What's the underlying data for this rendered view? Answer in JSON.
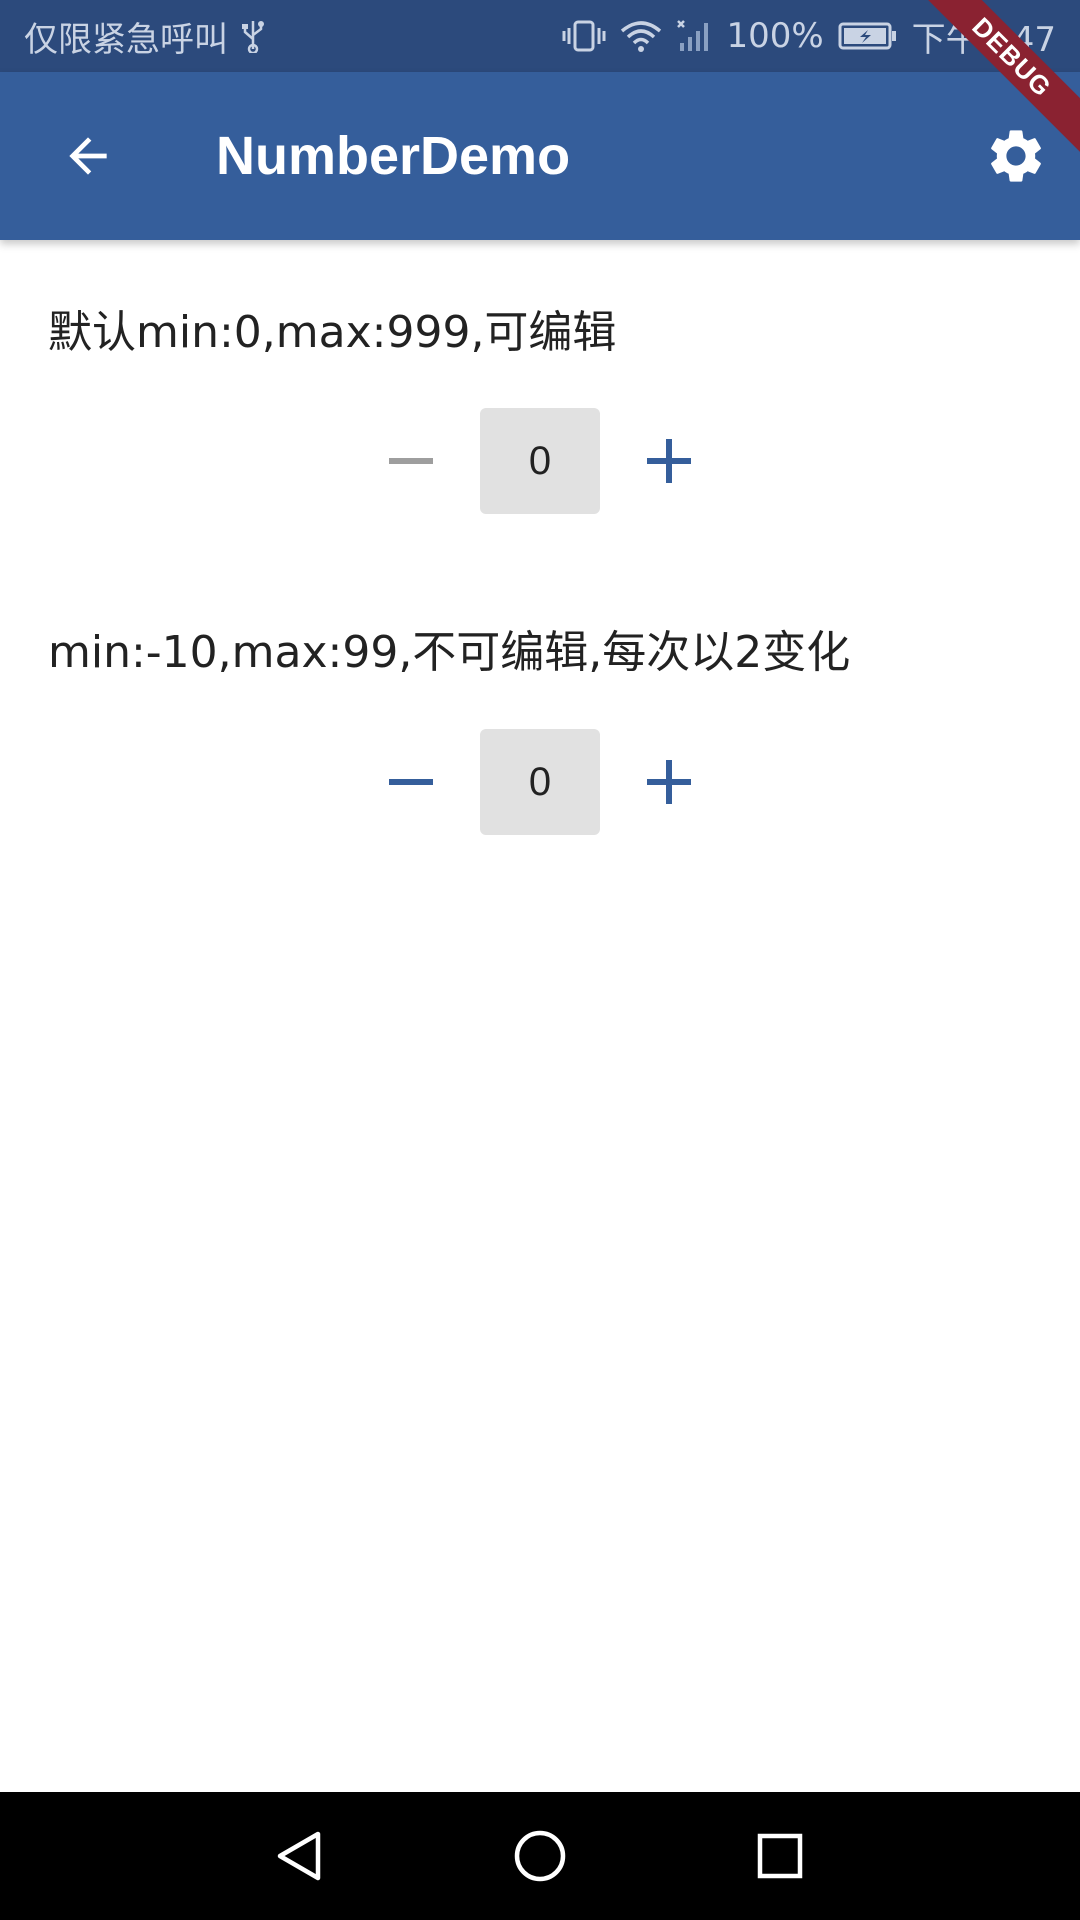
{
  "status_bar": {
    "carrier_text": "仅限紧急呼叫",
    "battery": "100%",
    "time": "下午2:47"
  },
  "app_bar": {
    "title": "NumberDemo"
  },
  "debug_banner": "DEBUG",
  "steppers": [
    {
      "label": "默认min:0,max:999,可编辑",
      "value": "0",
      "minus_enabled": false,
      "plus_enabled": true
    },
    {
      "label": "min:-10,max:99,不可编辑,每次以2变化",
      "value": "0",
      "minus_enabled": true,
      "plus_enabled": true
    }
  ],
  "colors": {
    "status_bar": "#2c4a7c",
    "app_bar": "#355e9b",
    "accent": "#355e9b",
    "disabled": "#9e9e9e",
    "value_box": "#e1e1e1"
  },
  "icons": {
    "back": "arrow-back-icon",
    "settings": "gear-icon",
    "minus": "minus-icon",
    "plus": "plus-icon",
    "nav_back": "triangle-back-icon",
    "nav_home": "circle-home-icon",
    "nav_recents": "square-recents-icon"
  }
}
